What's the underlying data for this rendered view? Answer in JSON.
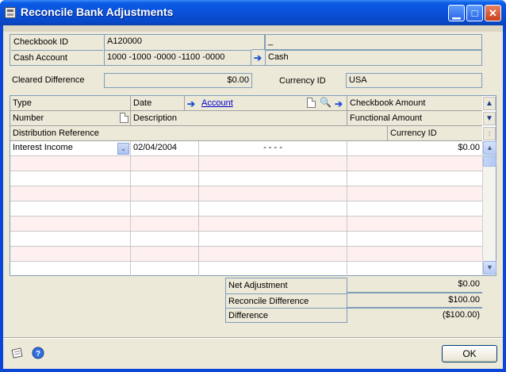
{
  "window": {
    "title": "Reconcile Bank Adjustments"
  },
  "header": {
    "checkbook_id_label": "Checkbook ID",
    "checkbook_id_value": "A120000",
    "checkbook_desc": "_",
    "cash_account_label": "Cash Account",
    "cash_account_value": "1000 -1000 -0000 -1100 -0000",
    "cash_account_desc": "Cash",
    "cleared_diff_label": "Cleared Difference",
    "cleared_diff_value": "$0.00",
    "currency_id_label": "Currency ID",
    "currency_id_value": "USA"
  },
  "grid": {
    "headers": {
      "type": "Type",
      "date": "Date",
      "account": "Account",
      "checkbook_amount": "Checkbook Amount",
      "number": "Number",
      "description": "Description",
      "functional_amount": "Functional Amount",
      "distribution_reference": "Distribution Reference",
      "currency_id": "Currency ID"
    },
    "first_row": {
      "type": "Interest Income",
      "date": "02/04/2004",
      "account": "-       -       -       -",
      "amount": "$0.00"
    }
  },
  "totals": {
    "net_adjustment_label": "Net Adjustment",
    "net_adjustment_value": "$0.00",
    "reconcile_difference_label": "Reconcile Difference",
    "reconcile_difference_value": "$100.00",
    "difference_label": "Difference",
    "difference_value": "($100.00)"
  },
  "footer": {
    "ok_label": "OK"
  },
  "colors": {
    "titlebar": "#0a50d8",
    "window_bg": "#ece9d8",
    "link": "#0000cc",
    "alt_row": "#fff0f0"
  },
  "icons": [
    "app-icon",
    "minimize-icon",
    "maximize-icon",
    "close-icon",
    "lookup-arrow-icon",
    "note-icon",
    "zoom-icon",
    "expand-icon",
    "collapse-icon",
    "note-pad-icon",
    "help-icon"
  ]
}
